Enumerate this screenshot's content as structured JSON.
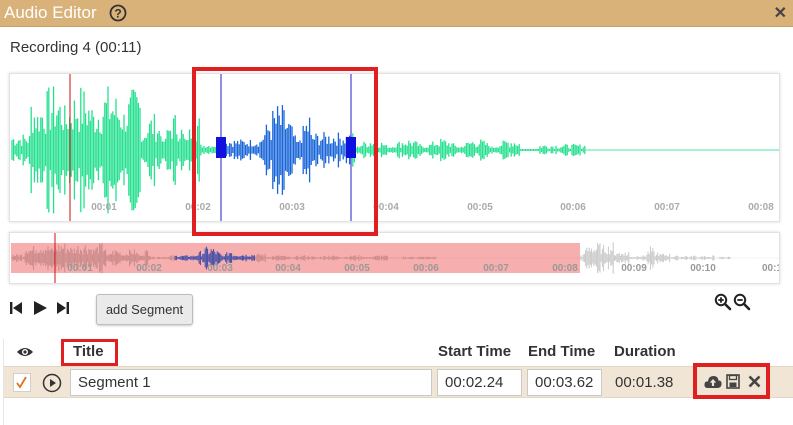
{
  "window": {
    "title": "Audio Editor",
    "help_icon": "help-circle-icon",
    "close_icon": "close-icon"
  },
  "recording": {
    "label": "Recording 4 (00:11)"
  },
  "waveform": {
    "time_labels": [
      "00:01",
      "00:02",
      "00:03",
      "00:04",
      "00:05",
      "00:06",
      "00:07",
      "00:08"
    ],
    "playhead_time": "00:00.6",
    "selection": {
      "start": "00:02.24",
      "end": "00:03.62"
    },
    "colors": {
      "wave": "#26e08f",
      "selected_wave": "#1a66d9",
      "playhead": "#cc1111",
      "selection_line": "#1f1fcc",
      "handle": "#1111dd"
    }
  },
  "overview": {
    "time_labels": [
      "00:01",
      "00:02",
      "00:03",
      "00:04",
      "00:05",
      "00:06",
      "00:07",
      "00:08",
      "00:09",
      "00:10",
      "00:1"
    ],
    "visible_range_color": "#f6a0a0"
  },
  "controls": {
    "skip_start_icon": "skip-start-icon",
    "play_icon": "play-icon",
    "skip_end_icon": "skip-end-icon",
    "add_segment_label": "add Segment",
    "zoom_in_icon": "zoom-in-icon",
    "zoom_out_icon": "zoom-out-icon"
  },
  "segments_table": {
    "headers": {
      "visibility_icon": "eye-icon",
      "title": "Title",
      "start_time": "Start Time",
      "end_time": "End Time",
      "duration": "Duration"
    },
    "rows": [
      {
        "checked": true,
        "title": "Segment 1",
        "start_time": "00:02.24",
        "end_time": "00:03.62",
        "duration": "00:01.38",
        "actions": [
          "cloud-upload-icon",
          "save-icon",
          "delete-icon"
        ]
      }
    ]
  },
  "highlight_color": "#e02020"
}
